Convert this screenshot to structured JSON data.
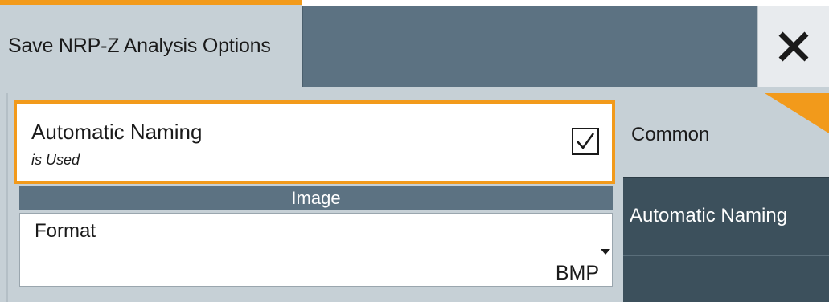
{
  "dialog": {
    "title": "Save NRP-Z Analysis Options",
    "close_icon": "close-icon"
  },
  "automatic_naming": {
    "label": "Automatic Naming",
    "status": "is Used",
    "checked": true
  },
  "image_section": {
    "header": "Image",
    "format_label": "Format",
    "format_value": "BMP"
  },
  "side_nav": {
    "items": [
      {
        "label": "Common",
        "active": true
      },
      {
        "label": "Automatic Naming",
        "active": false
      },
      {
        "label": "",
        "active": false
      }
    ]
  },
  "colors": {
    "accent": "#f29a1b",
    "title_bar": "#5c7282",
    "panel_bg": "#c6d0d6",
    "nav_dark": "#3c505c"
  }
}
